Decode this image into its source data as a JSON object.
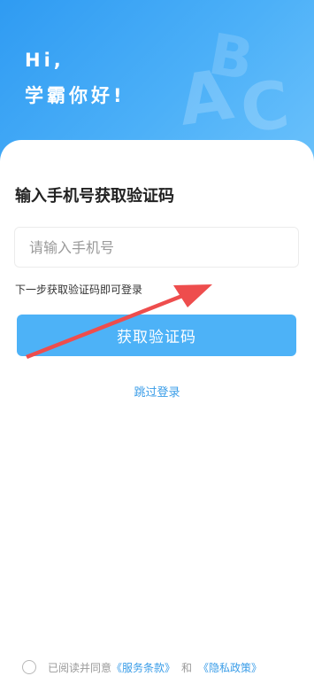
{
  "header": {
    "greeting_line1": "Hi,",
    "greeting_line2": "学霸你好!",
    "decoration_letters": [
      "A",
      "B",
      "C"
    ]
  },
  "login": {
    "title": "输入手机号获取验证码",
    "phone_placeholder": "请输入手机号",
    "phone_value": "",
    "hint": "下一步获取验证码即可登录",
    "get_code_label": "获取验证码",
    "skip_label": "跳过登录"
  },
  "agreement": {
    "checked": false,
    "prefix": "已阅读并同意",
    "terms_label": "《服务条款》",
    "and": "和",
    "privacy_label": "《隐私政策》"
  },
  "colors": {
    "header_gradient_start": "#2f9bf2",
    "header_gradient_end": "#6cc2fb",
    "button": "#4db2f7",
    "link": "#3a9de8",
    "annotation_arrow": "#ee4d4d"
  },
  "icons": {
    "annotation": "red-arrow-annotation",
    "decoration": "abc-letters-icon",
    "checkbox": "radio-circle-icon"
  }
}
